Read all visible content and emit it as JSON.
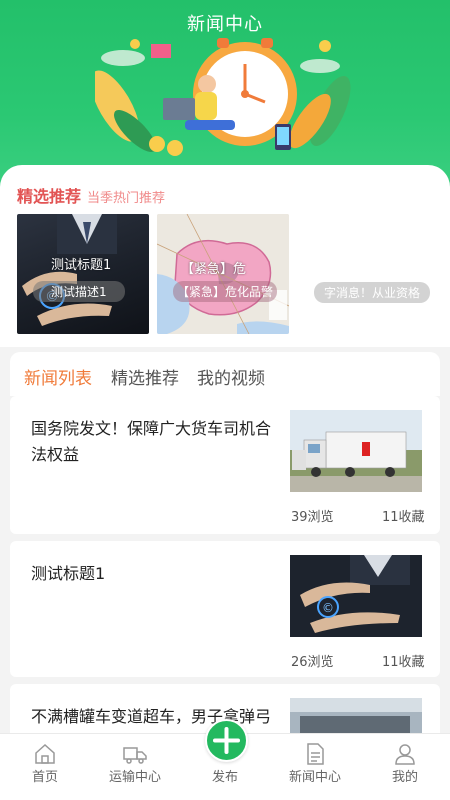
{
  "header": {
    "title": "新闻中心"
  },
  "recommend": {
    "title": "精选推荐",
    "subtitle": "当季热门推荐",
    "cards": [
      {
        "title": "测试标题1",
        "desc": "测试描述1"
      },
      {
        "title": "【紧急】危",
        "desc": "【紧急】危化品警"
      }
    ],
    "floating_desc": "字消息！从业资格"
  },
  "news": {
    "tabs": [
      "新闻列表",
      "精选推荐",
      "我的视频"
    ],
    "active_tab": 0,
    "items": [
      {
        "title": "国务院发文！保障广大货车司机合法权益",
        "views": "39浏览",
        "favorites": "11收藏"
      },
      {
        "title": "测试标题1",
        "views": "26浏览",
        "favorites": "11收藏"
      },
      {
        "title": "不满槽罐车变道超车，男子拿弹弓弹射钢珠被刑拘"
      }
    ]
  },
  "tabbar": {
    "items": [
      {
        "label": "首页",
        "icon": "home-icon"
      },
      {
        "label": "运输中心",
        "icon": "truck-icon"
      },
      {
        "label": "发布",
        "icon": "plus-icon"
      },
      {
        "label": "新闻中心",
        "icon": "document-icon"
      },
      {
        "label": "我的",
        "icon": "user-icon"
      }
    ]
  },
  "colors": {
    "brand_green": "#23c06a",
    "accent_red": "#e25454",
    "accent_orange": "#f07b3a"
  }
}
